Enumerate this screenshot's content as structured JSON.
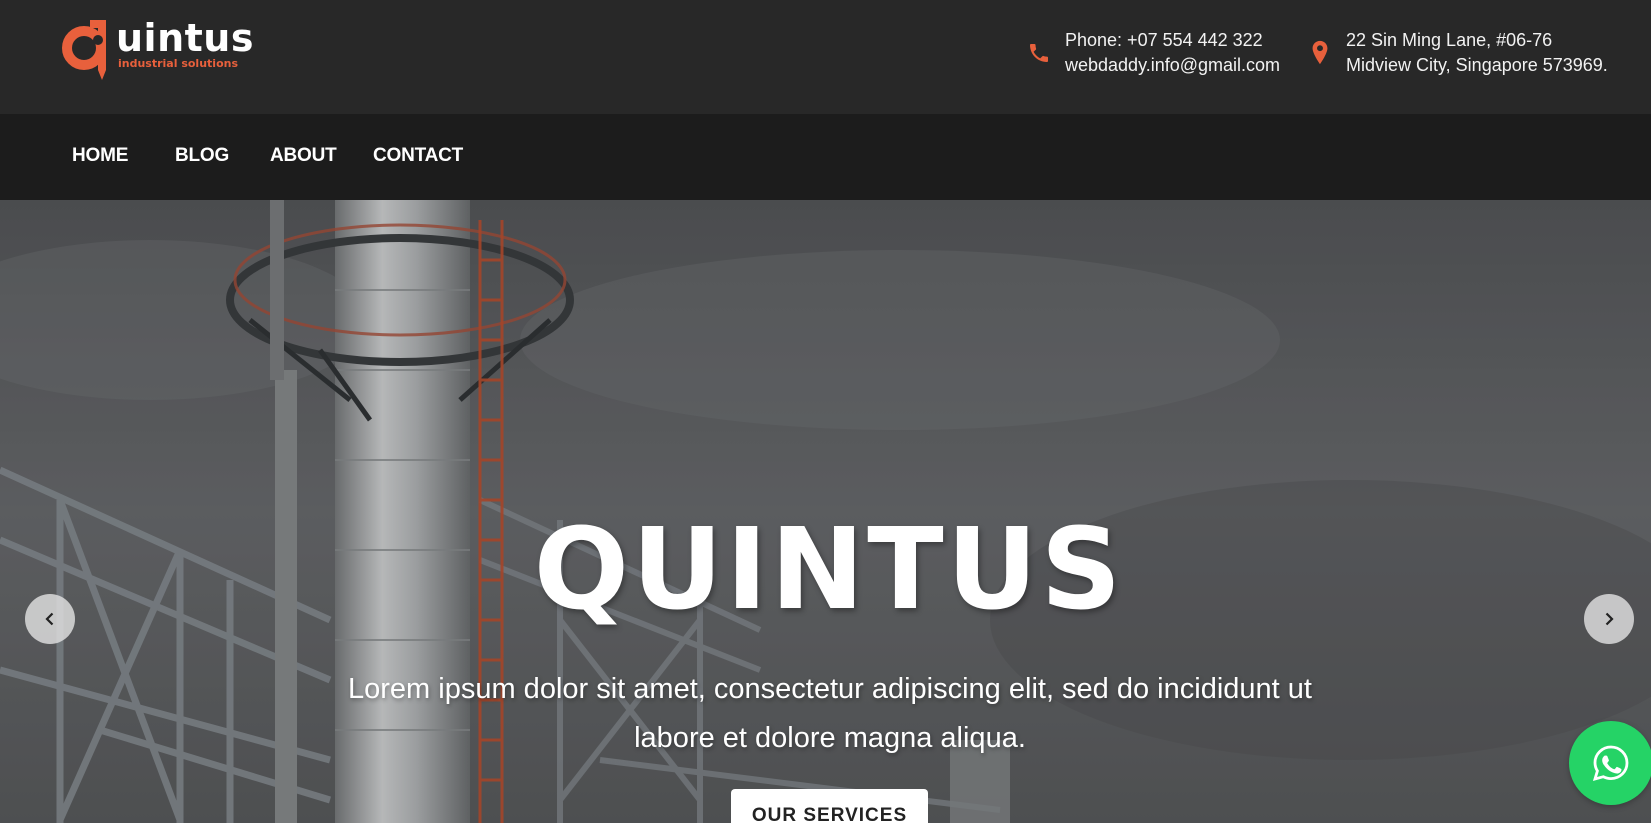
{
  "brand": {
    "name": "uintus",
    "tagline": "industrial solutions",
    "accent_color": "#e8603c",
    "logo_icon": "q-pin-logo-icon"
  },
  "header": {
    "phone_line": "Phone: +07 554 442 322",
    "email": "webdaddy.info@gmail.com",
    "phone_icon": "phone-icon",
    "address_line1": "22 Sin Ming Lane, #06-76",
    "address_line2": "Midview City, Singapore 573969.",
    "address_icon": "map-pin-icon"
  },
  "nav": {
    "items": [
      {
        "label": "HOME"
      },
      {
        "label": "BLOG"
      },
      {
        "label": "ABOUT"
      },
      {
        "label": "CONTACT"
      }
    ]
  },
  "hero": {
    "title": "QUINTUS",
    "subtitle": "Lorem ipsum dolor sit amet, consectetur adipiscing elit, sed do incididunt ut labore et dolore magna aliqua.",
    "button_label": "OUR SERVICES",
    "prev_icon": "chevron-left-icon",
    "next_icon": "chevron-right-icon"
  },
  "floating": {
    "whatsapp_icon": "whatsapp-icon",
    "whatsapp_color": "#25d366"
  }
}
